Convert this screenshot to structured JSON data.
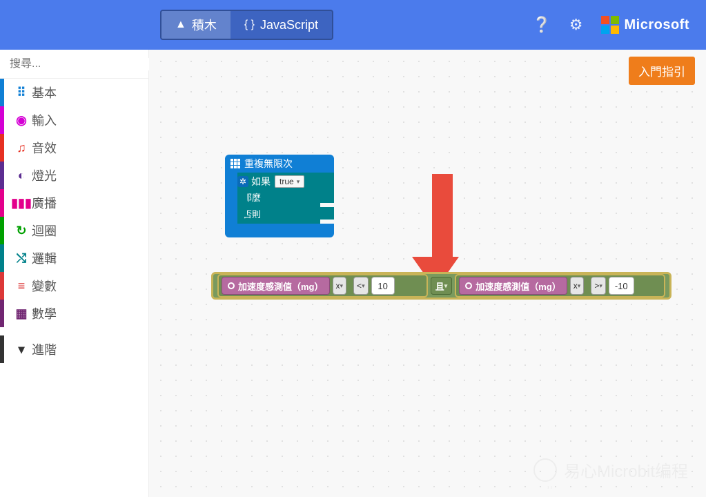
{
  "header": {
    "tab_blocks": "積木",
    "tab_js": "JavaScript",
    "brand": "Microsoft"
  },
  "sidebar": {
    "search_placeholder": "搜尋...",
    "cats": {
      "basic": "基本",
      "input": "輸入",
      "music": "音效",
      "led": "燈光",
      "radio": "廣播",
      "loops": "迴圈",
      "logic": "邏輯",
      "vars": "變數",
      "math": "數學",
      "adv": "進階"
    }
  },
  "canvas": {
    "guide_btn": "入門指引",
    "forever": {
      "title": "重複無限次",
      "if": "如果",
      "true": "true",
      "then": "那麼",
      "else": "否則"
    },
    "expr": {
      "accel": "加速度感測值（mg）",
      "axis": "x",
      "lt": "<",
      "gt": ">",
      "v1": "10",
      "v2": "-10",
      "and": "且"
    }
  },
  "watermark": "易心Microbit编程"
}
